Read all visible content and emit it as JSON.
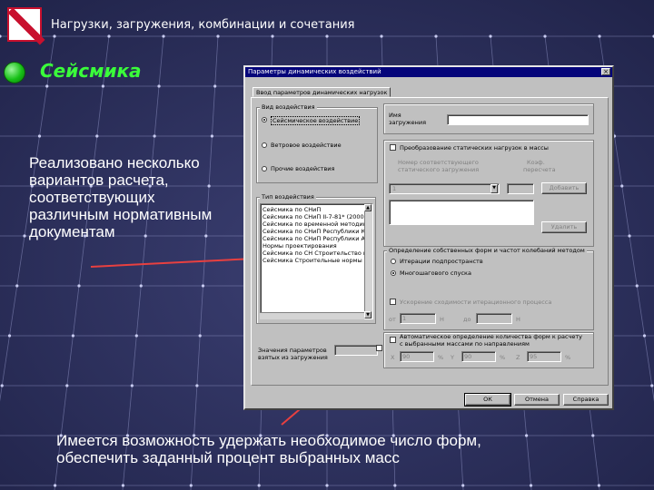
{
  "slide": {
    "title": "Нагрузки, загружения, комбинации и сочетания",
    "section": "Сейсмика",
    "description_lines": [
      "Реализовано несколько",
      "вариантов расчета,",
      "соответствующих",
      "различным нормативным",
      "документам"
    ],
    "note_lines": [
      "Имеется возможность удержать необходимое число форм,",
      "обеспечить заданный процент выбранных масс"
    ]
  },
  "icons": {
    "logo": "logo-icon",
    "bullet": "bullet-icon",
    "close": "close-icon",
    "dropdown": "chevron-down-icon",
    "scroll_up": "scroll-up-icon",
    "scroll_down": "scroll-down-icon"
  },
  "colors": {
    "background": "#262a52",
    "grid_line": "#8f93c4",
    "section_title": "#3aff3a",
    "bullet": "#16c016",
    "logo_red": "#c8102e",
    "dialog_face": "#c0c0c0",
    "titlebar": "#05057a",
    "arrow": "#e84040"
  },
  "dialog": {
    "title": "Параметры динамических воздействий",
    "close": "×",
    "tab": "Ввод параметров динамических нагрузок",
    "group_vozd": {
      "label": "Вид воздействия",
      "options": [
        "Сейсмическое воздействие",
        "Ветровое воздействие",
        "Прочие воздействия"
      ],
      "selected_index": 0
    },
    "group_list": {
      "label": "Тип воздействия",
      "items": [
        "Сейсмика по СНиП",
        "Сейсмика по СНиП II-7-81* (2000)",
        "Сейсмика по временной методике",
        "Сейсмика по СНиП Республики Казахстан",
        "Сейсмика по СНиП Республики Армения",
        "Нормы проектирования",
        "Сейсмика по СН Строительство в сейсмичных районах",
        "Сейсмика Строительные нормы РФ"
      ]
    },
    "load_name": {
      "label_lines": [
        "Имя",
        "загружения"
      ],
      "value": ""
    },
    "mass_transform": {
      "label": "Преобразование статических нагрузок в массы"
    },
    "conversion": {
      "col1_lines": [
        "Номер соответствующего",
        "статического загружения"
      ],
      "col2_lines": [
        "Коэф.",
        "пересчета"
      ],
      "combo_value": "1",
      "coef_value": "",
      "add_button": "Добавить"
    },
    "delete_button": "Удалить",
    "modes_method": {
      "label": "Определение собственных форм и частот колебаний методом",
      "options": [
        "Итерации подпространств",
        "Многошагового спуска"
      ],
      "selected_index": 1
    },
    "acceleration": {
      "label": "Ускорение сходимости итерационного процесса"
    },
    "param_row1": {
      "l1": "от",
      "v1": "1",
      "l2": "Н",
      "l3": "до",
      "v2": "",
      "l4": "Н"
    },
    "auto_modes": {
      "label_lines": [
        "Автоматическое определение количества форм к расчету",
        "с выбранными массами по направлениям"
      ]
    },
    "param_row2": {
      "l1": "X",
      "v1": "90",
      "l2": "Y",
      "v2": "90",
      "l3": "Z",
      "v3": "95",
      "u1": "%",
      "u2": "%",
      "u3": "%"
    },
    "params_block": {
      "label_lines": [
        "Значения параметров",
        "взятых из загружения"
      ]
    },
    "buttons": {
      "ok": "ОК",
      "cancel": "Отмена",
      "help": "Справка"
    }
  }
}
